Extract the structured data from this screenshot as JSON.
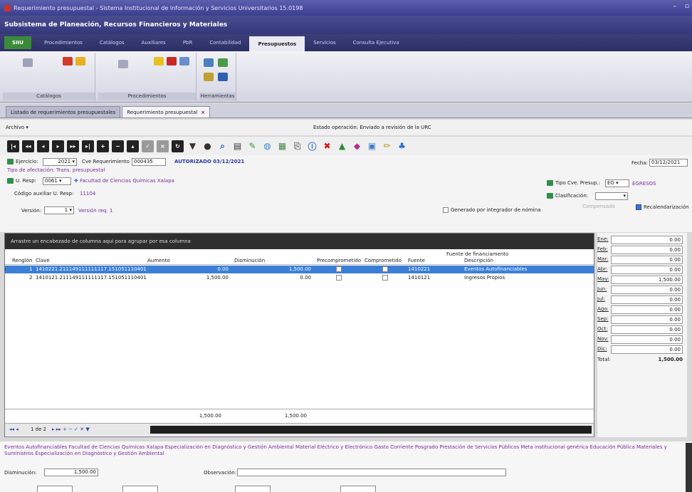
{
  "window": {
    "title": "Requerimiento presupuestal - Sistema Institucional de Información y Servicios Universitarios 15.0198",
    "min": "–",
    "max": "▫"
  },
  "subsystem": "Subsistema de Planeación, Recursos Financieros y Materiales",
  "menu": {
    "app": "SIIU",
    "items": [
      "Procedimientos",
      "Catálogos",
      "Auxiliares",
      "PbR",
      "Contabilidad",
      "Presupuestos",
      "Servicios",
      "Consulta Ejecutiva"
    ],
    "active": "Presupuestos"
  },
  "ribbon": {
    "groups": [
      "Catálogos",
      "Procedimientos",
      "Herramientas"
    ]
  },
  "doctabs": [
    {
      "label": "Listado de requerimientos presupuestales",
      "active": false
    },
    {
      "label": "Requerimiento presupuestal",
      "active": true
    }
  ],
  "archivo": "Archivo ▾",
  "estado": "Estado operación: Enviado a revisión de la URC",
  "form": {
    "ejercicio_label": "Ejercicio:",
    "ejercicio": "2021 ▾",
    "cve_label": "Cve Requerimiento",
    "cve": "000435",
    "autorizado": "AUTORIZADO 03/12/2021",
    "fecha_label": "Fecha:",
    "fecha": "03/12/2021",
    "tipo_afect": "Tipo de afectación: Trans. presupuestal",
    "uresp_label": "U. Resp:",
    "uresp": "0061 ▾",
    "uresp_name": "Facultad de Ciencias Químicas Xalapa",
    "codaux_label": "Código auxiliar U. Resp:",
    "codaux": "11104",
    "version_label": "Versión:",
    "version": "1 ▾",
    "version_req": "Versión req. 1",
    "tipocve_label": "Tipo Cve. Presup.:",
    "tipocve": "EG ▾",
    "egresos": "EGRESOS",
    "clasif_label": "Clasificación:",
    "clasif": "▾",
    "compensado": "Compensado",
    "generado": "Generado por integrador de nómina",
    "recal": "Recalendarización"
  },
  "grid": {
    "group_hint": "Arrastre un encabezado de columna aquí para agrupar por esa columna",
    "fuente_group": "Fuente de financiamento",
    "headers": [
      "Renglón",
      "Clave",
      "Aumento",
      "Disminución",
      "Precomprometido",
      "Comprometido",
      "Fuente",
      "Descripción"
    ],
    "rows": [
      {
        "n": "1",
        "clave": "1410221.211149111111117.151051110401",
        "aum": "0.00",
        "dis": "1,500.00",
        "fuente": "1410221",
        "desc": "Eventos Autofinanciables"
      },
      {
        "n": "2",
        "clave": "1410121.211149111111117.151051110401",
        "aum": "1,500.00",
        "dis": "0.00",
        "fuente": "1410121",
        "desc": "Ingresos Propios"
      }
    ],
    "tot_aum": "1,500.00",
    "tot_dis": "1,500.00",
    "pager": "1 de 2"
  },
  "months": [
    {
      "m": "Ene:",
      "v": "0.00"
    },
    {
      "m": "Feb:",
      "v": "0.00"
    },
    {
      "m": "Mar:",
      "v": "0.00"
    },
    {
      "m": "Abr:",
      "v": "0.00"
    },
    {
      "m": "May:",
      "v": "1,500.00"
    },
    {
      "m": "Jun:",
      "v": "0.00"
    },
    {
      "m": "Jul:",
      "v": "0.00"
    },
    {
      "m": "Ago:",
      "v": "0.00"
    },
    {
      "m": "Sep:",
      "v": "0.00"
    },
    {
      "m": "Oct:",
      "v": "0.00"
    },
    {
      "m": "Nov:",
      "v": "0.00"
    },
    {
      "m": "Dic:",
      "v": "0.00"
    }
  ],
  "total_label": "Total:",
  "total": "1,500.00",
  "bottom": {
    "crumb": "Eventos Autofinanciables  Facultad de Ciencias Químicas Xalapa  Especialización en Diagnóstico y Gestión Ambiental  Material Eléctrico y Electrónico  Gasto Corriente  Posgrado  Prestación de Servicios Públicos  Meta institucional genérica  Educación Pública  Materiales y Suministros  Especialización en Diagnóstico y Gestión Ambiental",
    "dis_label": "Disminución:",
    "dis": "1,500.00",
    "obs_label": "Observación:"
  },
  "colors": {
    "accent": "#3b3f8f",
    "selected": "#3b7fd8",
    "purple": "#7a2aa0"
  }
}
